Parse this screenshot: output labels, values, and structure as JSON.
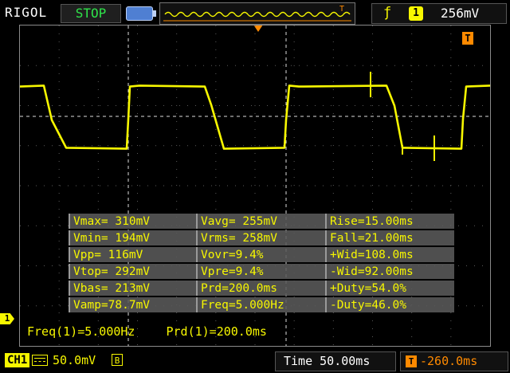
{
  "header": {
    "brand": "RIGOL",
    "run_state": "STOP",
    "trigger_source": "1",
    "trigger_level": "256mV",
    "trigger_marker": "T"
  },
  "channel": {
    "label": "CH1",
    "marker": "1",
    "scale": "50.0mV",
    "bandwidth": "B",
    "color": "#f7f700"
  },
  "timebase": {
    "time": "Time 50.00ms",
    "offset": "-260.0ms",
    "offset_icon": "T"
  },
  "measurements": [
    [
      "Vmax= 310mV",
      "Vavg= 255mV",
      "Rise=15.00ms"
    ],
    [
      "Vmin= 194mV",
      "Vrms= 258mV",
      "Fall=21.00ms"
    ],
    [
      "Vpp= 116mV",
      "Vovr=9.4%",
      "+Wid=108.0ms"
    ],
    [
      "Vtop= 292mV",
      "Vpre=9.4%",
      "-Wid=92.00ms"
    ],
    [
      "Vbas= 213mV",
      "Prd=200.0ms",
      "+Duty=54.0%"
    ],
    [
      "Vamp=78.7mV",
      "Freq=5.000Hz",
      "-Duty=46.0%"
    ]
  ],
  "readout": {
    "freq": "Freq(1)=5.000Hz",
    "prd": "Prd(1)=200.0ms"
  },
  "colors": {
    "trace": "#f7f700",
    "trigger": "#ff8a00",
    "run_state": "#2fe44a"
  }
}
